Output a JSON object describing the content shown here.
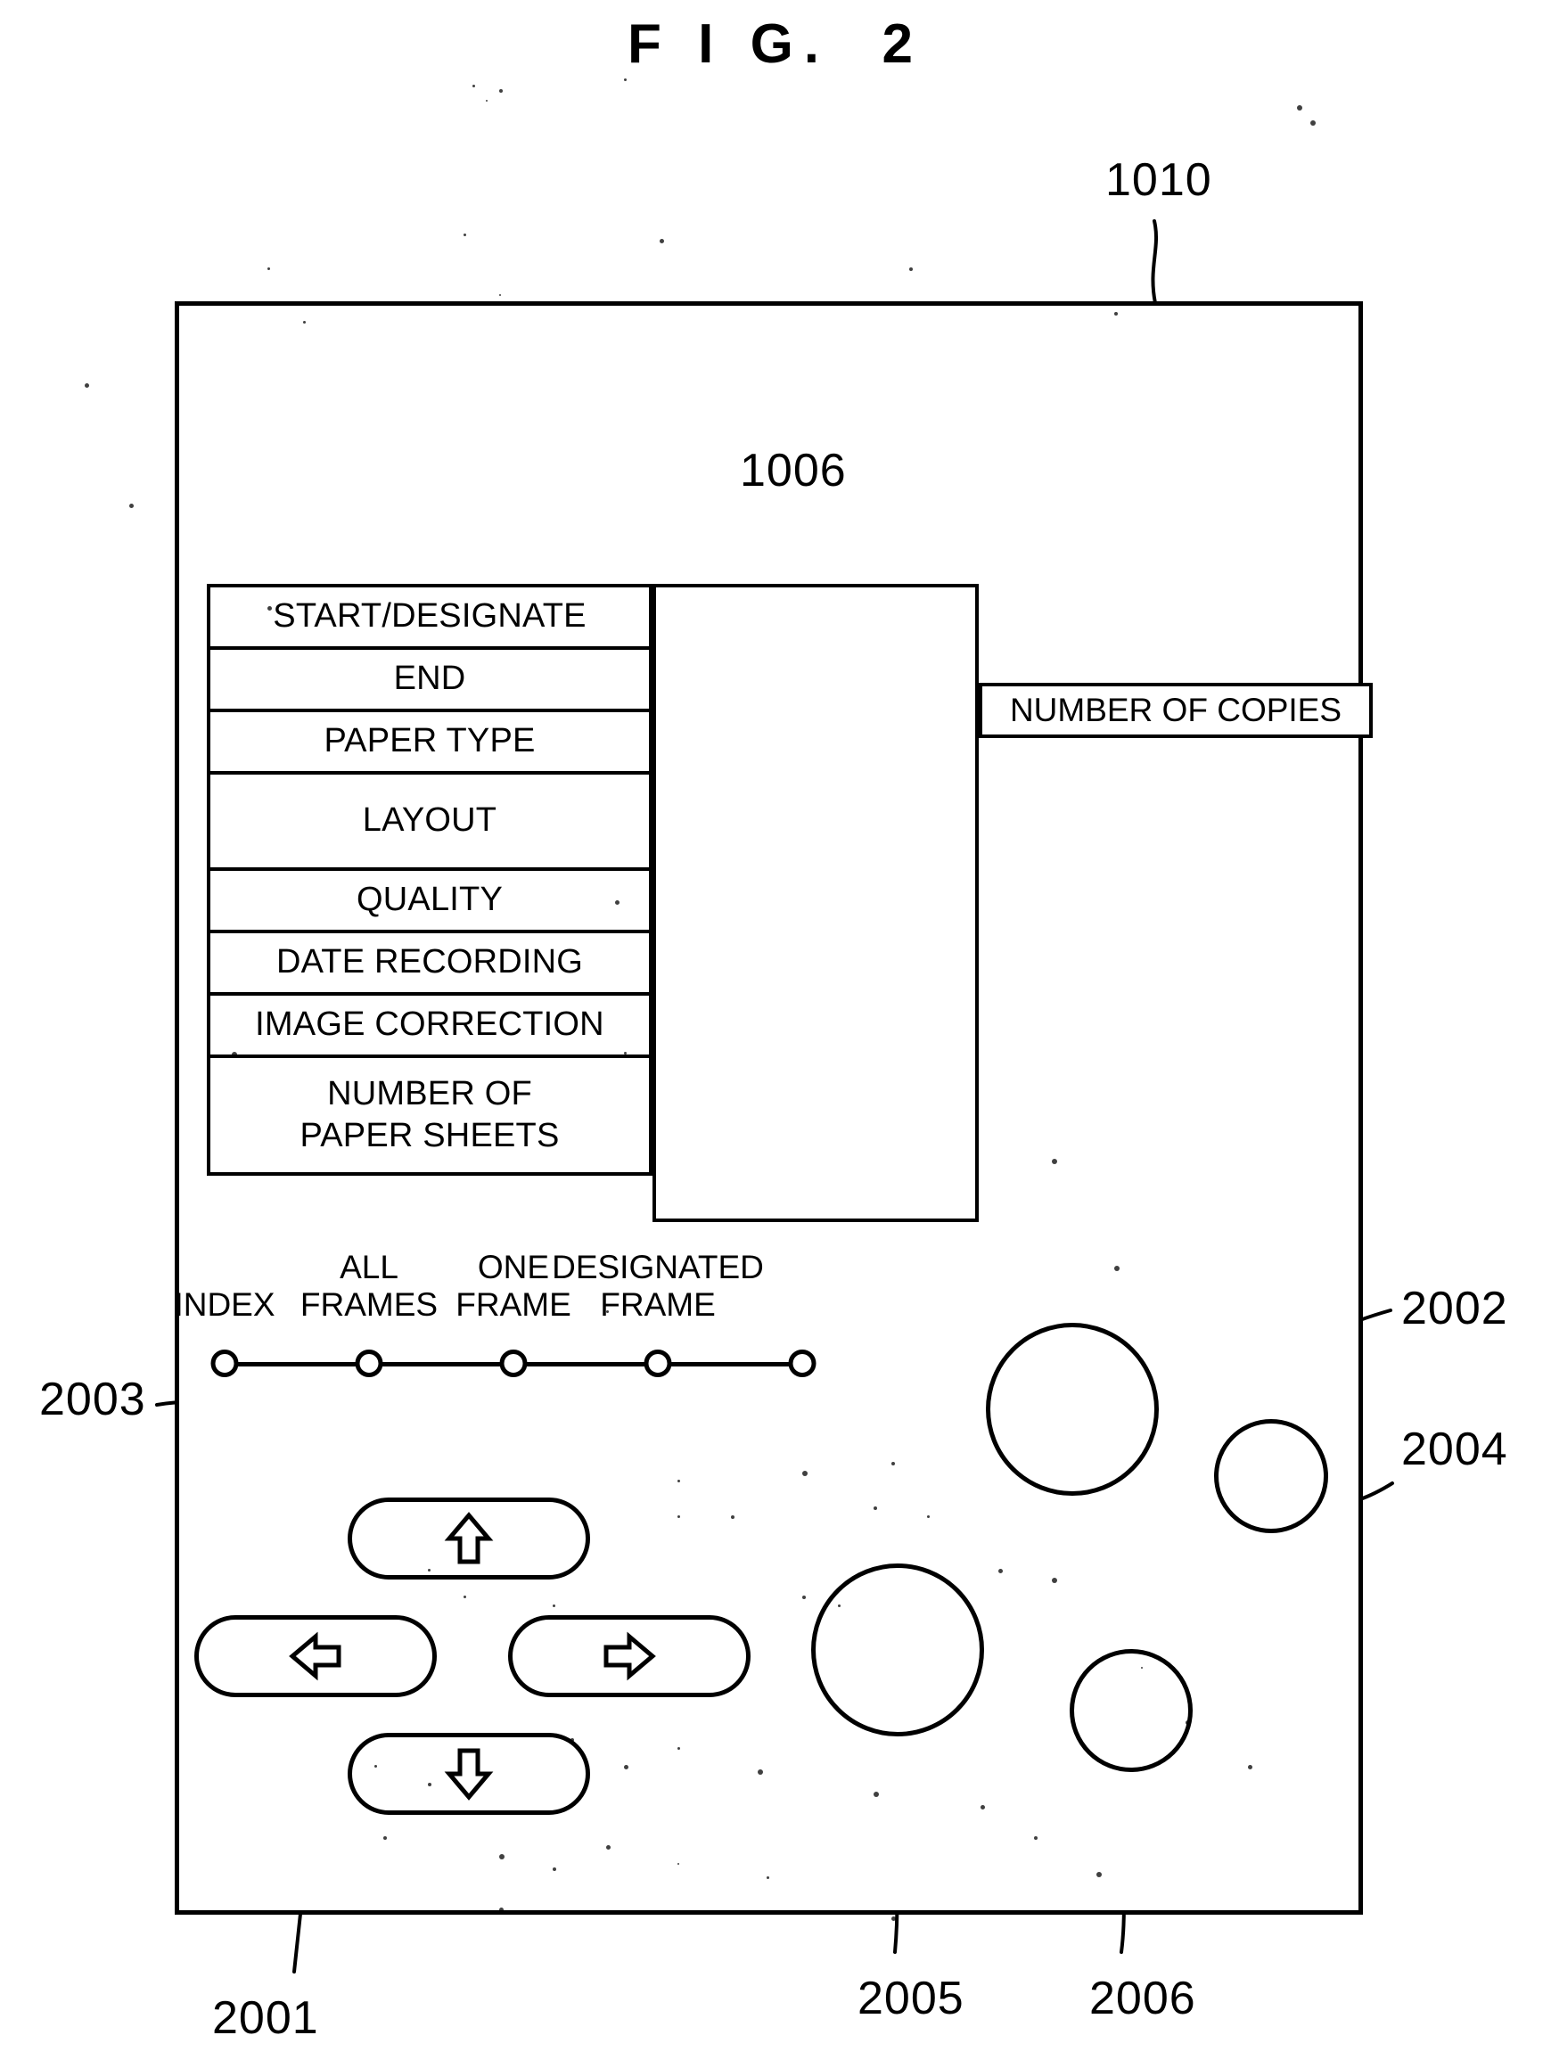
{
  "figure": {
    "title": "F I G.  2",
    "panel_ref": "1010",
    "display_ref": "1006"
  },
  "menu": {
    "rows": [
      {
        "label": "START/DESIGNATE",
        "lines": [
          "START/DESIGNATE"
        ]
      },
      {
        "label": "END",
        "lines": [
          "END"
        ]
      },
      {
        "label": "PAPER TYPE",
        "lines": [
          "PAPER TYPE"
        ]
      },
      {
        "label": "LAYOUT",
        "lines": [
          "LAYOUT"
        ]
      },
      {
        "label": "QUALITY",
        "lines": [
          "QUALITY"
        ]
      },
      {
        "label": "DATE RECORDING",
        "lines": [
          "DATE RECORDING"
        ]
      },
      {
        "label": "IMAGE CORRECTION",
        "lines": [
          "IMAGE CORRECTION"
        ]
      },
      {
        "label": "NUMBER OF PAPER SHEETS",
        "lines": [
          "NUMBER OF",
          "PAPER SHEETS"
        ]
      }
    ],
    "row_0": "START/DESIGNATE",
    "row_1": "END",
    "row_2": "PAPER TYPE",
    "row_3": "LAYOUT",
    "row_4": "QUALITY",
    "row_5": "DATE RECORDING",
    "row_6": "IMAGE CORRECTION",
    "row_7_line1": "NUMBER OF",
    "row_7_line2": "PAPER SHEETS"
  },
  "copies": {
    "label": "NUMBER OF COPIES"
  },
  "mode_selector": {
    "ref": "2003",
    "node_count": 5,
    "options": [
      {
        "label": "INDEX",
        "line1": "",
        "line2": "INDEX"
      },
      {
        "label": "ALL FRAMES",
        "line1": "ALL",
        "line2": "FRAMES"
      },
      {
        "label": "ONE FRAME",
        "line1": "ONE",
        "line2": "FRAME"
      },
      {
        "label": "DESIGNATED FRAME",
        "line1": "DESIGNATED",
        "line2": "FRAME"
      }
    ],
    "option_0": "INDEX",
    "option_1": "ALL\nFRAMES",
    "option_2": "ONE\nFRAME",
    "option_3": "DESIGNATED\nFRAME"
  },
  "arrow_pad": {
    "ref": "2001",
    "buttons": [
      {
        "name": "up-arrow-button",
        "glyph": "up-arrow-icon"
      },
      {
        "name": "left-arrow-button",
        "glyph": "left-arrow-icon"
      },
      {
        "name": "right-arrow-button",
        "glyph": "right-arrow-icon"
      },
      {
        "name": "down-arrow-button",
        "glyph": "down-arrow-icon"
      }
    ]
  },
  "round_buttons": [
    {
      "ref": "2002",
      "size": "large"
    },
    {
      "ref": "2004",
      "size": "small"
    },
    {
      "ref": "2005",
      "size": "large"
    },
    {
      "ref": "2006",
      "size": "small"
    }
  ],
  "refs": {
    "r1010": "1010",
    "r1006": "1006",
    "r2001": "2001",
    "r2002": "2002",
    "r2003": "2003",
    "r2004": "2004",
    "r2005": "2005",
    "r2006": "2006"
  },
  "colors": {
    "ink": "#000000",
    "paper": "#ffffff"
  }
}
